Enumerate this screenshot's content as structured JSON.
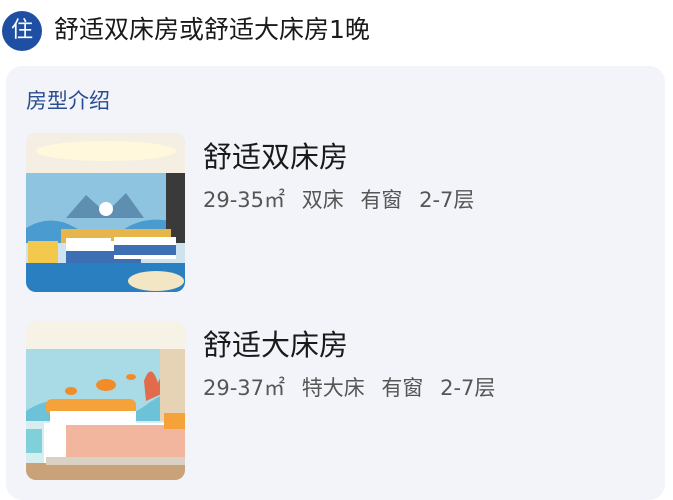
{
  "header": {
    "badge": "住",
    "title": "舒适双床房或舒适大床房1晚"
  },
  "section": {
    "title": "房型介绍"
  },
  "rooms": [
    {
      "name": "舒适双床房",
      "area": "29-35㎡",
      "bed": "双床",
      "window": "有窗",
      "floor": "2-7层"
    },
    {
      "name": "舒适大床房",
      "area": "29-37㎡",
      "bed": "特大床",
      "window": "有窗",
      "floor": "2-7层"
    }
  ],
  "colors": {
    "accent": "#1f4fa3",
    "section_title": "#2a4c93",
    "card_bg": "#f2f4f9"
  }
}
